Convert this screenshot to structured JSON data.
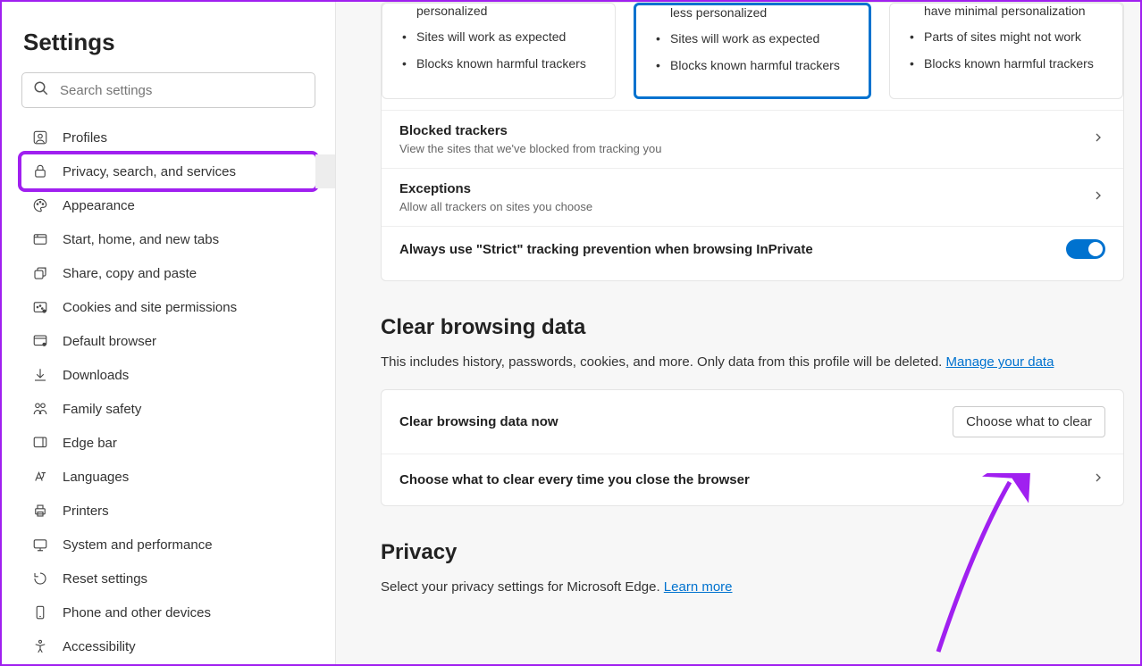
{
  "sidebar": {
    "title": "Settings",
    "search_placeholder": "Search settings",
    "items": [
      {
        "label": "Profiles",
        "icon": "profile-icon"
      },
      {
        "label": "Privacy, search, and services",
        "icon": "lock-icon"
      },
      {
        "label": "Appearance",
        "icon": "palette-icon"
      },
      {
        "label": "Start, home, and new tabs",
        "icon": "tabs-icon"
      },
      {
        "label": "Share, copy and paste",
        "icon": "share-icon"
      },
      {
        "label": "Cookies and site permissions",
        "icon": "cookie-icon"
      },
      {
        "label": "Default browser",
        "icon": "browser-icon"
      },
      {
        "label": "Downloads",
        "icon": "download-icon"
      },
      {
        "label": "Family safety",
        "icon": "family-icon"
      },
      {
        "label": "Edge bar",
        "icon": "edgebar-icon"
      },
      {
        "label": "Languages",
        "icon": "language-icon"
      },
      {
        "label": "Printers",
        "icon": "printer-icon"
      },
      {
        "label": "System and performance",
        "icon": "system-icon"
      },
      {
        "label": "Reset settings",
        "icon": "reset-icon"
      },
      {
        "label": "Phone and other devices",
        "icon": "phone-icon"
      },
      {
        "label": "Accessibility",
        "icon": "accessibility-icon"
      }
    ]
  },
  "tracking": {
    "options": [
      {
        "top": "personalized",
        "li1": "Sites will work as expected",
        "li2": "Blocks known harmful trackers"
      },
      {
        "top": "less personalized",
        "li1": "Sites will work as expected",
        "li2": "Blocks known harmful trackers"
      },
      {
        "top": "have minimal personalization",
        "li1": "Parts of sites might not work",
        "li2": "Blocks known harmful trackers"
      }
    ],
    "blocked_title": "Blocked trackers",
    "blocked_sub": "View the sites that we've blocked from tracking you",
    "exceptions_title": "Exceptions",
    "exceptions_sub": "Allow all trackers on sites you choose",
    "strict_label": "Always use \"Strict\" tracking prevention when browsing InPrivate"
  },
  "clear_data": {
    "heading": "Clear browsing data",
    "desc": "This includes history, passwords, cookies, and more. Only data from this profile will be deleted. ",
    "manage_link": "Manage your data",
    "now_label": "Clear browsing data now",
    "choose_btn": "Choose what to clear",
    "close_label": "Choose what to clear every time you close the browser"
  },
  "privacy": {
    "heading": "Privacy",
    "desc": "Select your privacy settings for Microsoft Edge. ",
    "learn_link": "Learn more"
  }
}
